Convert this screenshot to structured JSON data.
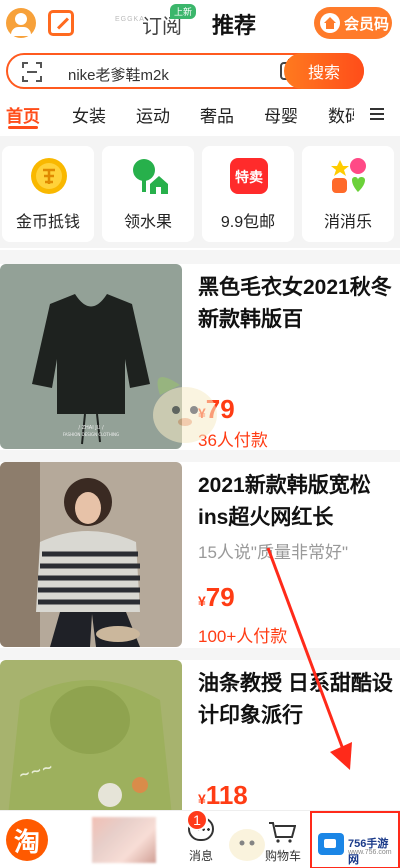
{
  "header": {
    "follow_label": "订阅",
    "new_badge": "上新",
    "recommend_label": "推荐",
    "vip_label": "会员码",
    "ghost_text": "EGGKA"
  },
  "search": {
    "query": "nike老爹鞋m2k",
    "button_label": "搜索"
  },
  "categories": [
    {
      "label": "首页",
      "active": true
    },
    {
      "label": "女装",
      "active": false
    },
    {
      "label": "运动",
      "active": false
    },
    {
      "label": "奢品",
      "active": false
    },
    {
      "label": "母婴",
      "active": false
    },
    {
      "label": "数码",
      "active": false
    }
  ],
  "tiles": [
    {
      "label": "金币抵钱",
      "icon": "gold-coin-icon"
    },
    {
      "label": "领水果",
      "icon": "fruit-tree-icon"
    },
    {
      "label": "9.9包邮",
      "icon": "special-sale-icon",
      "icon_text": "特卖"
    },
    {
      "label": "消消乐",
      "icon": "match-game-icon"
    }
  ],
  "products": [
    {
      "title": "黑色毛衣女2021秋冬新款韩版百",
      "price_symbol": "¥",
      "price": "79",
      "sold": "36人付款",
      "image_caption": "/ ZHAI JU /",
      "image_caption_sub": "FASHION DESIGN CLOTHING"
    },
    {
      "title": "2021新款韩版宽松ins超火网红长",
      "quote": "15人说\"质量非常好\"",
      "price_symbol": "¥",
      "price": "79",
      "sold": "100+人付款"
    },
    {
      "title": "油条教授 日系甜酷设计印象派行",
      "price_symbol": "¥",
      "price": "118"
    }
  ],
  "tabbar": {
    "home_logo": "淘",
    "messages_label": "消息",
    "messages_badge": "1",
    "cart_label": "购物车",
    "watermark_text": "756手游网",
    "watermark_sub": "www.756.com"
  },
  "colors": {
    "accent": "#ff4d1a",
    "price": "#ff3c14",
    "vip": "#ff7b2a"
  }
}
